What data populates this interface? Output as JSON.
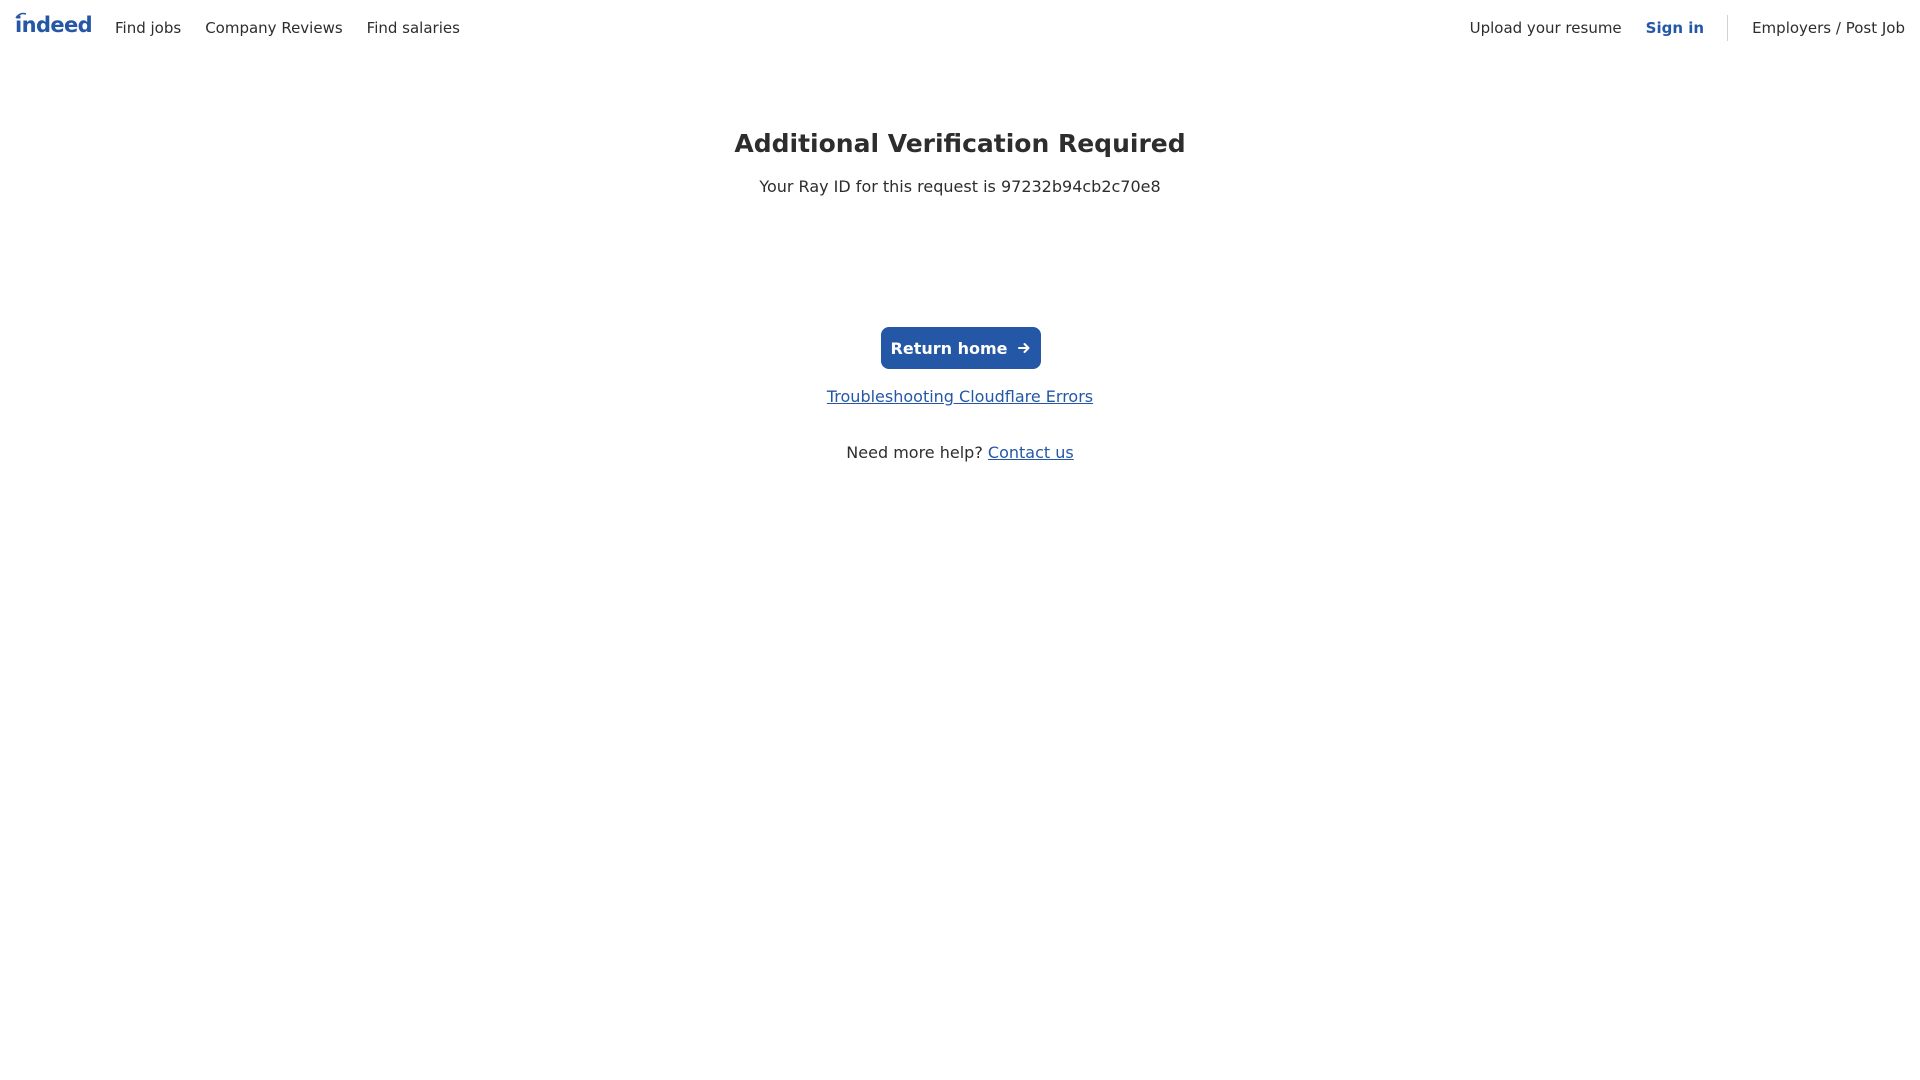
{
  "header": {
    "logo_text": "indeed",
    "nav_left": [
      "Find jobs",
      "Company Reviews",
      "Find salaries"
    ],
    "upload_label": "Upload your resume",
    "signin_label": "Sign in",
    "employers_label": "Employers / Post Job"
  },
  "main": {
    "title": "Additional Verification Required",
    "ray_prefix": "Your Ray ID for this request is ",
    "ray_id": "97232b94cb2c70e8",
    "return_button_label": "Return home",
    "troubleshooting_link": "Troubleshooting Cloudflare Errors",
    "help_prefix": "Need more help? ",
    "contact_link": "Contact us"
  },
  "colors": {
    "brand_blue": "#2557a7",
    "text": "#2d2d2d",
    "divider": "#d4d2d0",
    "background": "#ffffff"
  },
  "icons": {
    "return_button_icon": "arrow-right-icon",
    "logo_mark": "indeed-swoosh-icon"
  }
}
